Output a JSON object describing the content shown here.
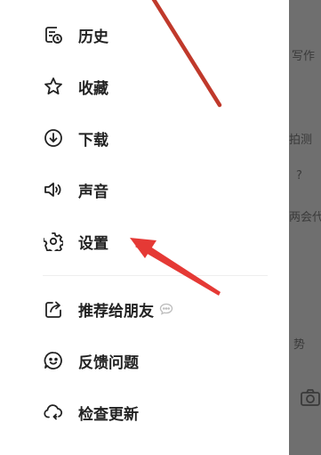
{
  "menu": {
    "items": [
      {
        "label": "历史",
        "icon": "history-icon"
      },
      {
        "label": "收藏",
        "icon": "star-icon"
      },
      {
        "label": "下载",
        "icon": "download-icon"
      },
      {
        "label": "声音",
        "icon": "speaker-icon"
      },
      {
        "label": "设置",
        "icon": "gear-icon"
      },
      {
        "label": "推荐给朋友",
        "icon": "share-icon",
        "badge_icon": "chat-bubble-icon"
      },
      {
        "label": "反馈问题",
        "icon": "feedback-smile-icon"
      },
      {
        "label": "检查更新",
        "icon": "refresh-cloud-icon"
      }
    ]
  },
  "background_page": {
    "fragments": [
      "写作",
      "拍测",
      "?",
      "两会代",
      "势"
    ]
  },
  "annotation": {
    "color": "#e53935",
    "target": "设置"
  }
}
